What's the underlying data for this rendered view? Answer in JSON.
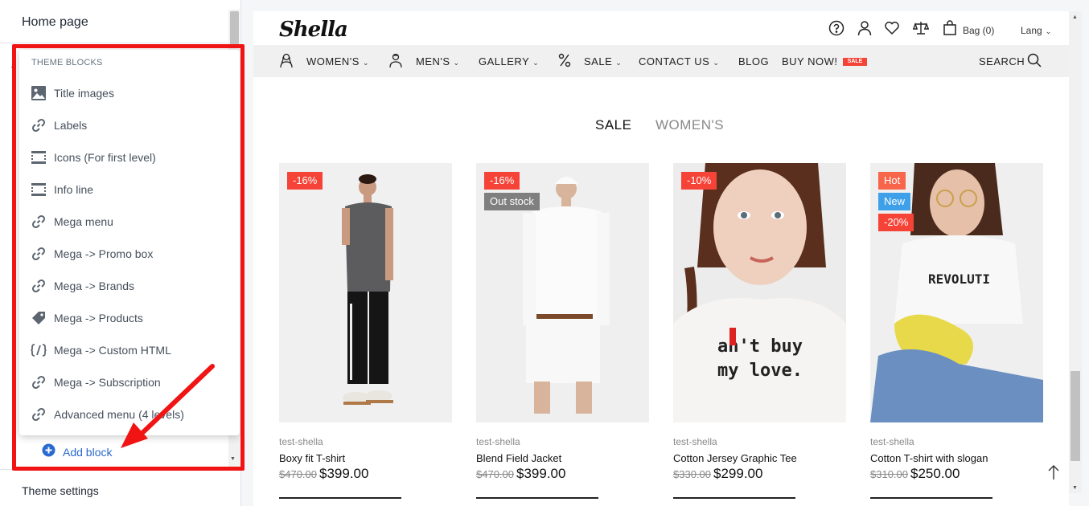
{
  "sidebar": {
    "title": "Home page",
    "popup_heading": "THEME BLOCKS",
    "items": [
      {
        "label": "Title images",
        "icon": "image-icon"
      },
      {
        "label": "Labels",
        "icon": "link-icon"
      },
      {
        "label": "Icons (For first level)",
        "icon": "section-icon"
      },
      {
        "label": "Info line",
        "icon": "section-icon"
      },
      {
        "label": "Mega menu",
        "icon": "link-icon"
      },
      {
        "label": "Mega -> Promo box",
        "icon": "link-icon"
      },
      {
        "label": "Mega -> Brands",
        "icon": "link-icon"
      },
      {
        "label": "Mega -> Products",
        "icon": "tag-icon"
      },
      {
        "label": "Mega -> Custom HTML",
        "icon": "code-icon"
      },
      {
        "label": "Mega -> Subscription",
        "icon": "link-icon"
      },
      {
        "label": "Advanced menu (4 levels)",
        "icon": "link-icon"
      }
    ],
    "add_block": "Add block",
    "theme_settings": "Theme settings"
  },
  "store": {
    "logo": "Shella",
    "bag": "Bag (0)",
    "lang": "Lang",
    "nav": [
      "WOMEN'S",
      "MEN'S",
      "GALLERY",
      "SALE",
      "CONTACT US",
      "BLOG",
      "BUY NOW!"
    ],
    "sale_badge": "SALE",
    "search": "SEARCH",
    "tabs": [
      "SALE",
      "WOMEN'S"
    ]
  },
  "products": [
    {
      "vendor": "test-shella",
      "name": "Boxy fit T-shirt",
      "old_price": "$470.00",
      "price": "$399.00",
      "badges": [
        "-16%"
      ]
    },
    {
      "vendor": "test-shella",
      "name": "Blend Field Jacket",
      "old_price": "$470.00",
      "price": "$399.00",
      "badges": [
        "-16%",
        "Out stock"
      ]
    },
    {
      "vendor": "test-shella",
      "name": "Cotton Jersey Graphic Tee",
      "old_price": "$330.00",
      "price": "$299.00",
      "badges": [
        "-10%"
      ]
    },
    {
      "vendor": "test-shella",
      "name": "Cotton T-shirt with slogan",
      "old_price": "$310.00",
      "price": "$250.00",
      "badges": [
        "Hot",
        "New",
        "-20%"
      ]
    }
  ],
  "colors": {
    "annotation": "#f01414",
    "discount_badge": "#f54337",
    "out_stock_badge": "#7f7f7f",
    "hot_badge": "#f7664b",
    "new_badge": "#3ea0e8",
    "link_blue": "#2a6ad0"
  }
}
